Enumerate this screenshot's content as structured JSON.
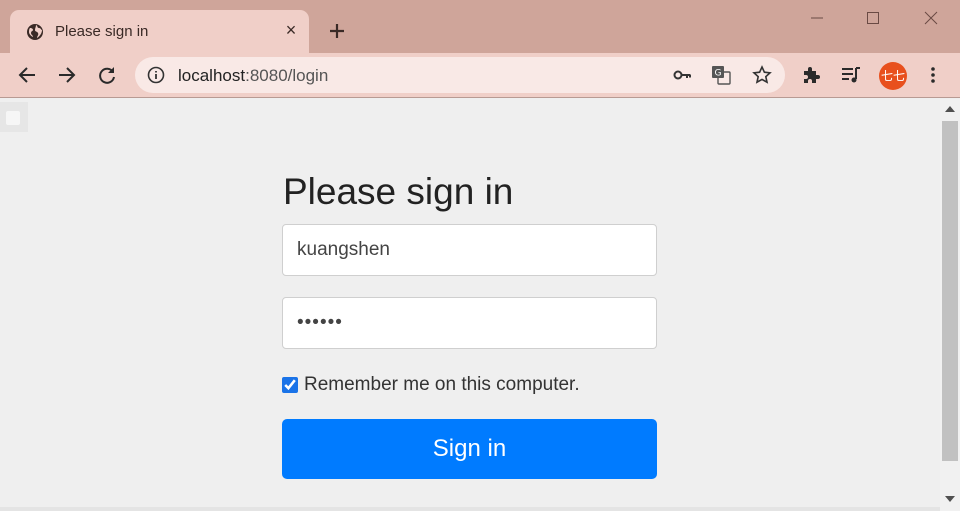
{
  "browser": {
    "tab": {
      "title": "Please sign in",
      "close": "×"
    },
    "url": {
      "host": "localhost",
      "rest": ":8080/login"
    },
    "profile": {
      "label": "七七",
      "color": "#e8501d"
    },
    "colors": {
      "frame": "#cfa59a",
      "toolbar": "#f0cfc8",
      "omnibox": "#f9e9e6"
    }
  },
  "page": {
    "heading": "Please sign in",
    "username": {
      "value": "kuangshen"
    },
    "password": {
      "value": "••••••"
    },
    "remember": {
      "label": "Remember me on this computer.",
      "checked": true
    },
    "submit": {
      "label": "Sign in",
      "color": "#007bff"
    }
  },
  "icons": [
    "globe-icon",
    "close-icon",
    "plus-icon",
    "minimize-icon",
    "maximize-icon",
    "window-close-icon",
    "back-icon",
    "forward-icon",
    "reload-icon",
    "info-icon",
    "key-icon",
    "translate-icon",
    "star-icon",
    "extensions-icon",
    "media-icon",
    "menu-icon"
  ]
}
